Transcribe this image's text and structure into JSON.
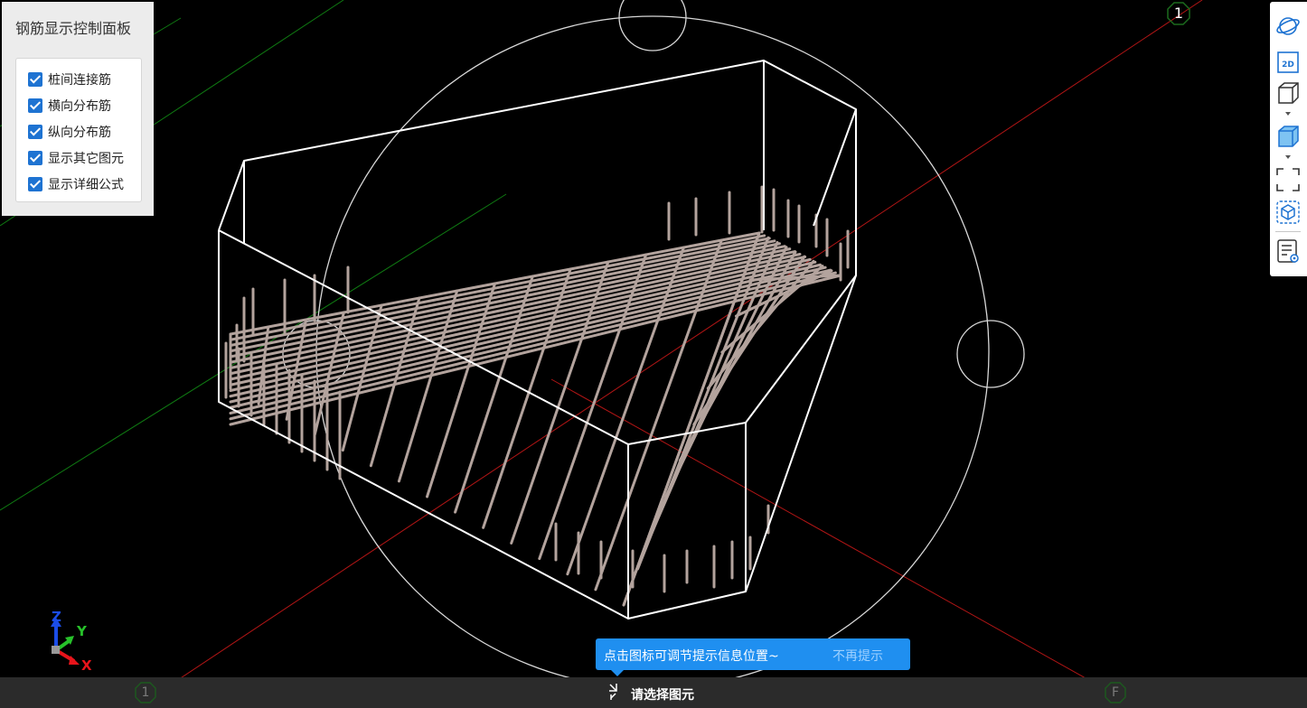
{
  "panel": {
    "title": "钢筋显示控制面板",
    "options": [
      {
        "label": "桩间连接筋",
        "checked": true
      },
      {
        "label": "横向分布筋",
        "checked": true
      },
      {
        "label": "纵向分布筋",
        "checked": true
      },
      {
        "label": "显示其它图元",
        "checked": true
      },
      {
        "label": "显示详细公式",
        "checked": true
      }
    ]
  },
  "toolbar": {
    "buttons": [
      {
        "icon": "orbit-icon"
      },
      {
        "icon": "2d-view-icon",
        "label": "2D"
      },
      {
        "icon": "wireframe-cube-icon"
      },
      {
        "icon": "solid-cube-icon"
      },
      {
        "icon": "fit-view-icon"
      },
      {
        "icon": "element-view-icon"
      },
      {
        "icon": "property-list-icon"
      }
    ]
  },
  "axes": {
    "x": "X",
    "y": "Y",
    "z": "Z",
    "x_color": "#e8141b",
    "y_color": "#27c12a",
    "z_color": "#1b4de8"
  },
  "grid_markers": {
    "top_right": "1",
    "bottom_left": "1",
    "bottom_right": "F"
  },
  "tooltip": {
    "message": "点击图标可调节提示信息位置~",
    "dismiss": "不再提示"
  },
  "status": {
    "prompt": "请选择图元"
  },
  "colors": {
    "accent": "#1f8ff0",
    "rebar": "#b3a39d",
    "wireframe": "#ffffff",
    "grid_red": "#b01515",
    "grid_green": "#0f7a12"
  }
}
